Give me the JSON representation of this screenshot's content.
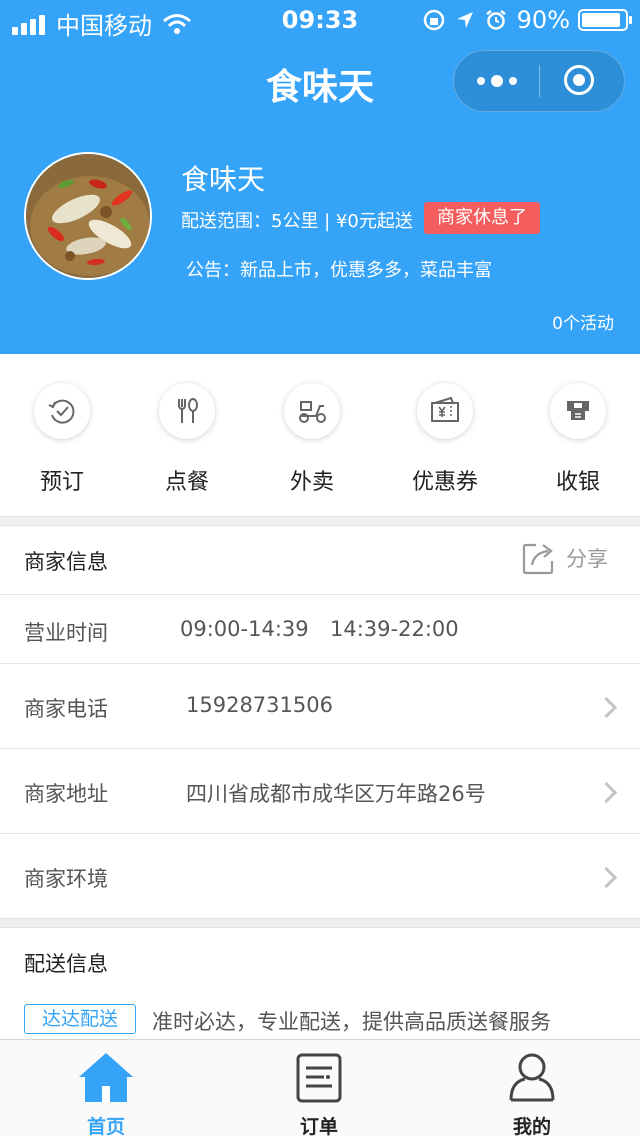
{
  "status_bar": {
    "carrier": "中国移动",
    "time": "09:33",
    "battery": "90%",
    "battery_level": 0.9
  },
  "nav": {
    "title": "食味天"
  },
  "shop": {
    "name": "食味天",
    "delivery": "配送范围：5公里 | ¥0元起送",
    "status_badge": "商家休息了",
    "notice": "公告：新品上市，优惠多多，菜品丰富",
    "activities": "0个活动"
  },
  "shortcuts": [
    {
      "label": "预订",
      "icon": "reserve-icon"
    },
    {
      "label": "点餐",
      "icon": "fork-knife-icon"
    },
    {
      "label": "外卖",
      "icon": "scooter-icon"
    },
    {
      "label": "优惠券",
      "icon": "coupon-icon"
    },
    {
      "label": "收银",
      "icon": "cashier-icon"
    }
  ],
  "merchant_info": {
    "title": "商家信息",
    "share_label": "分享",
    "hours_label": "营业时间",
    "hours_1": "09:00-14:39",
    "hours_2": "14:39-22:00",
    "phone_label": "商家电话",
    "phone": "15928731506",
    "address_label": "商家地址",
    "address": "四川省成都市成华区万年路26号",
    "environment_label": "商家环境"
  },
  "delivery_info": {
    "title": "配送信息",
    "tag": "达达配送",
    "description": "准时必达，专业配送，提供高品质送餐服务"
  },
  "tabbar": [
    {
      "label": "首页",
      "icon": "home-icon",
      "active": true
    },
    {
      "label": "订单",
      "icon": "order-list-icon",
      "active": false
    },
    {
      "label": "我的",
      "icon": "user-icon",
      "active": false
    }
  ],
  "colors": {
    "primary": "#35a3f7",
    "badge": "#f45d5d",
    "background": "#ffffff",
    "separator": "#efefef"
  }
}
